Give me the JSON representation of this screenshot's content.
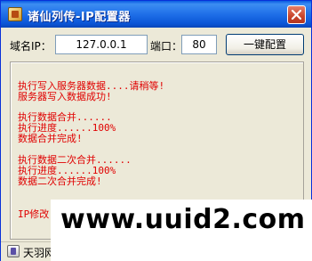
{
  "window": {
    "title": "诸仙列传-IP配置器",
    "icon": "app-icon",
    "close_icon": "close-icon"
  },
  "config": {
    "ip_label": "域名IP：",
    "ip_value": "127.0.0.1",
    "port_label": "端口：",
    "port_value": "80",
    "configure_button": "一键配置"
  },
  "log": {
    "lines": [
      "执行写入服务器数据....请稍等!",
      "服务器写入数据成功!",
      "执行数据合并......",
      "执行进度......100%",
      "数据合并完成!",
      "执行数据二次合并......",
      "执行进度......100%",
      "数据二次合并完成!",
      "IP修改"
    ],
    "color": "#e00000"
  },
  "statusbar": {
    "text": "天羽网",
    "icon": "status-app-icon"
  },
  "watermark": {
    "text": "www.uuid2.com"
  }
}
